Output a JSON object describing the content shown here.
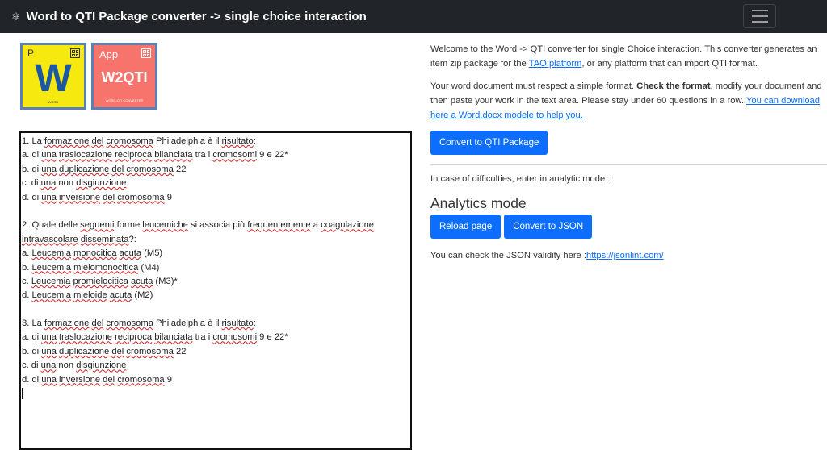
{
  "navbar": {
    "brand_icon": "⚛",
    "title": "Word to QTI Package converter -> single choice interaction"
  },
  "logos": {
    "word": {
      "tag": "P",
      "letter": "W",
      "caption": "WORD"
    },
    "app": {
      "tag": "App",
      "name": "W2QTI",
      "caption": "WORD-QTI CONVERTER"
    }
  },
  "editor": {
    "lines": [
      [
        "1. La ",
        {
          "s": "formazione"
        },
        " ",
        {
          "s": "del"
        },
        " ",
        {
          "s": "cromosoma"
        },
        " Philadelphia è il ",
        {
          "s": "risultato"
        },
        ":"
      ],
      [
        "a. di ",
        {
          "s": "una"
        },
        " ",
        {
          "s": "traslocazione"
        },
        " ",
        {
          "s": "reciproca"
        },
        " ",
        {
          "s": "bilanciata"
        },
        " tra i ",
        {
          "s": "cromosomi"
        },
        " 9 e 22*"
      ],
      [
        "b. di ",
        {
          "s": "una"
        },
        " ",
        {
          "s": "duplicazione"
        },
        " ",
        {
          "s": "del"
        },
        " ",
        {
          "s": "cromosoma"
        },
        " 22"
      ],
      [
        "c. di ",
        {
          "s": "una"
        },
        " non ",
        {
          "s": "disgiunzione"
        }
      ],
      [
        "d. di ",
        {
          "s": "una"
        },
        " ",
        {
          "s": "inversione"
        },
        " ",
        {
          "s": "del"
        },
        " ",
        {
          "s": "cromosoma"
        },
        " 9"
      ],
      [
        ""
      ],
      [
        "2. Quale delle ",
        {
          "s": "seguenti"
        },
        " forme ",
        {
          "s": "leucemiche"
        },
        " si associa più ",
        {
          "s": "frequentemente"
        },
        " a ",
        {
          "s": "coagulazione"
        }
      ],
      [
        {
          "s": "intravascolare"
        },
        " ",
        {
          "s": "disseminata"
        },
        "?:"
      ],
      [
        "a. ",
        {
          "s": "Leucemia"
        },
        " ",
        {
          "s": "monocitica"
        },
        " ",
        {
          "s": "acuta"
        },
        " (M5)"
      ],
      [
        "b. ",
        {
          "s": "Leucemia"
        },
        " ",
        {
          "s": "mielomonocitica"
        },
        " (M4)"
      ],
      [
        "c. ",
        {
          "s": "Leucemia"
        },
        " ",
        {
          "s": "promielocitica"
        },
        " ",
        {
          "s": "acuta"
        },
        " (M3)*"
      ],
      [
        "d. ",
        {
          "s": "Leucemia"
        },
        " ",
        {
          "s": "mieloide"
        },
        " ",
        {
          "s": "acuta"
        },
        " (M2)"
      ],
      [
        ""
      ],
      [
        "3. La ",
        {
          "s": "formazione"
        },
        " ",
        {
          "s": "del"
        },
        " ",
        {
          "s": "cromosoma"
        },
        " Philadelphia è il ",
        {
          "s": "risultato"
        },
        ":"
      ],
      [
        "a. di ",
        {
          "s": "una"
        },
        " ",
        {
          "s": "traslocazione"
        },
        " ",
        {
          "s": "reciproca"
        },
        " ",
        {
          "s": "bilanciata"
        },
        " tra i ",
        {
          "s": "cromosomi"
        },
        " 9 e 22*"
      ],
      [
        "b. di ",
        {
          "s": "una"
        },
        " ",
        {
          "s": "duplicazione"
        },
        " ",
        {
          "s": "del"
        },
        " ",
        {
          "s": "cromosoma"
        },
        " 22"
      ],
      [
        "c. di ",
        {
          "s": "una"
        },
        " non ",
        {
          "s": "disgiunzione"
        }
      ],
      [
        "d. di ",
        {
          "s": "una"
        },
        " ",
        {
          "s": "inversione"
        },
        " ",
        {
          "s": "del"
        },
        " ",
        {
          "s": "cromosoma"
        },
        " 9"
      ]
    ]
  },
  "intro": {
    "p1_before": "Welcome to the Word -> QTI converter for single Choice interaction. This converter generates an item zip package for the ",
    "p1_link": "TAO platform",
    "p1_after": ", or any platform that can import QTI format.",
    "p2_before": "Your word document must respect a simple format. ",
    "p2_bold": "Check the format",
    "p2_mid": ", modify your document and then paste your work in the text area. Please stay under 60 questions in a row. ",
    "p2_link": "You can download here a Word.docx modele to help you."
  },
  "buttons": {
    "convert_qti": "Convert to QTI Package",
    "reload": "Reload page",
    "convert_json": "Convert to JSON"
  },
  "analytics": {
    "difficulty_text": "In case of difficulties, enter in analytic mode :",
    "heading": "Analytics mode",
    "json_check_before": "You can check the JSON validity here :",
    "json_check_link": "https://jsonlint.com/"
  },
  "colors": {
    "navbar_bg": "#212529",
    "primary": "#0d6efd",
    "word_logo_bg": "#f5e90f",
    "app_logo_bg": "#f6746b",
    "spellcheck": "#d21e1e"
  }
}
